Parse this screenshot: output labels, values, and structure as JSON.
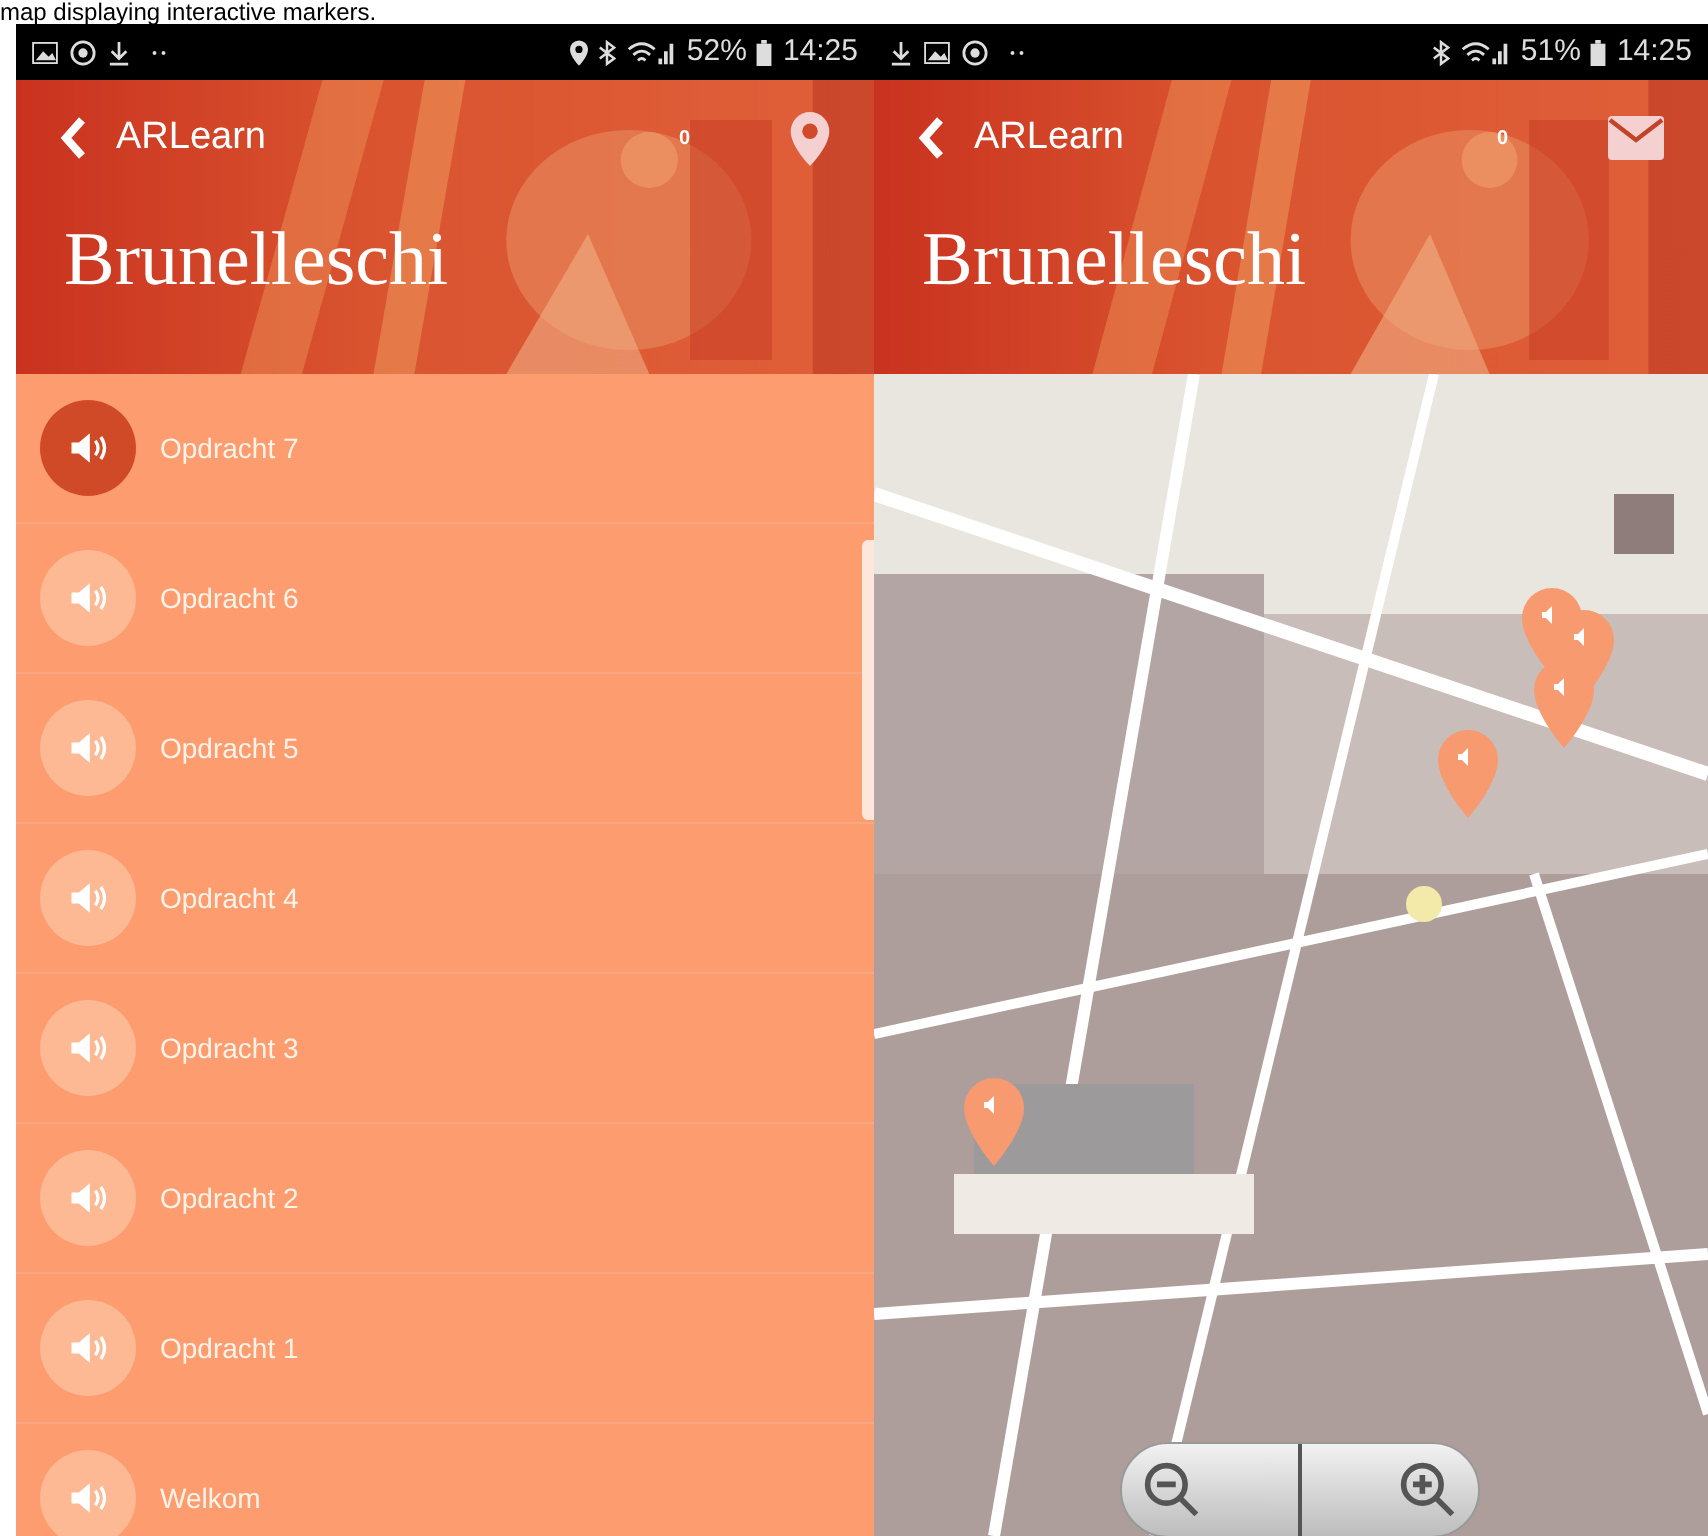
{
  "caption": "map displaying interactive markers.",
  "screens": [
    {
      "kind": "list",
      "status_bar": {
        "battery": "52%",
        "time": "14:25"
      },
      "header": {
        "back_label": "ARLearn",
        "count": "0",
        "action": {
          "kind": "location"
        },
        "title": "Brunelleschi"
      },
      "items": [
        {
          "label": "Opdracht 7",
          "selected": true
        },
        {
          "label": "Opdracht 6",
          "selected": false
        },
        {
          "label": "Opdracht 5",
          "selected": false
        },
        {
          "label": "Opdracht 4",
          "selected": false
        },
        {
          "label": "Opdracht 3",
          "selected": false
        },
        {
          "label": "Opdracht 2",
          "selected": false
        },
        {
          "label": "Opdracht 1",
          "selected": false
        },
        {
          "label": "Welkom",
          "selected": false
        }
      ]
    },
    {
      "kind": "map",
      "status_bar": {
        "battery": "51%",
        "time": "14:25"
      },
      "header": {
        "back_label": "ARLearn",
        "count": "0",
        "action": {
          "kind": "mail"
        },
        "title": "Brunelleschi"
      }
    }
  ]
}
